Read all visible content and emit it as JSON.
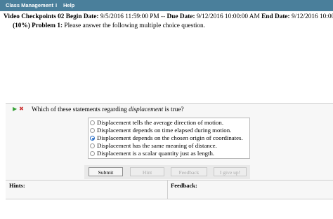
{
  "menu": {
    "class_management": "Class Management",
    "separator": "I",
    "help": "Help"
  },
  "header": {
    "assignment": "Video Checkpoints 02",
    "begin_label": "Begin Date:",
    "begin_value": "9/5/2016 11:59:00 PM --",
    "due_label": "Due Date:",
    "due_value": "9/12/2016 10:00:00 AM",
    "end_label": "End Date:",
    "end_value": "9/12/2016 10:00:0"
  },
  "problem": {
    "weight": "(10%) Problem 1:",
    "instruction": "Please answer the following multiple choice question."
  },
  "question": {
    "prefix": "Which of these statements regarding ",
    "emphasis": "displacement",
    "suffix": " is true?"
  },
  "options": [
    {
      "label": "Displacement tells the average direction of motion.",
      "selected": false
    },
    {
      "label": "Displacement depends on time elapsed during motion.",
      "selected": false
    },
    {
      "label": "Displacement depends on the chosen origin of coordinates.",
      "selected": true
    },
    {
      "label": "Displacement has the same meaning of distance.",
      "selected": false
    },
    {
      "label": "Displacement is a scalar quantity just as length.",
      "selected": false
    }
  ],
  "buttons": {
    "submit": "Submit",
    "hint": "Hint",
    "feedback": "Feedback",
    "give_up": "I give up!"
  },
  "panes": {
    "hints": "Hints:",
    "feedback": "Feedback:"
  },
  "colors": {
    "menubar": "#4a7f9b",
    "selected_radio": "#2b6fc7",
    "play_icon": "#3aa33a",
    "x_icon": "#cc3a3a"
  }
}
